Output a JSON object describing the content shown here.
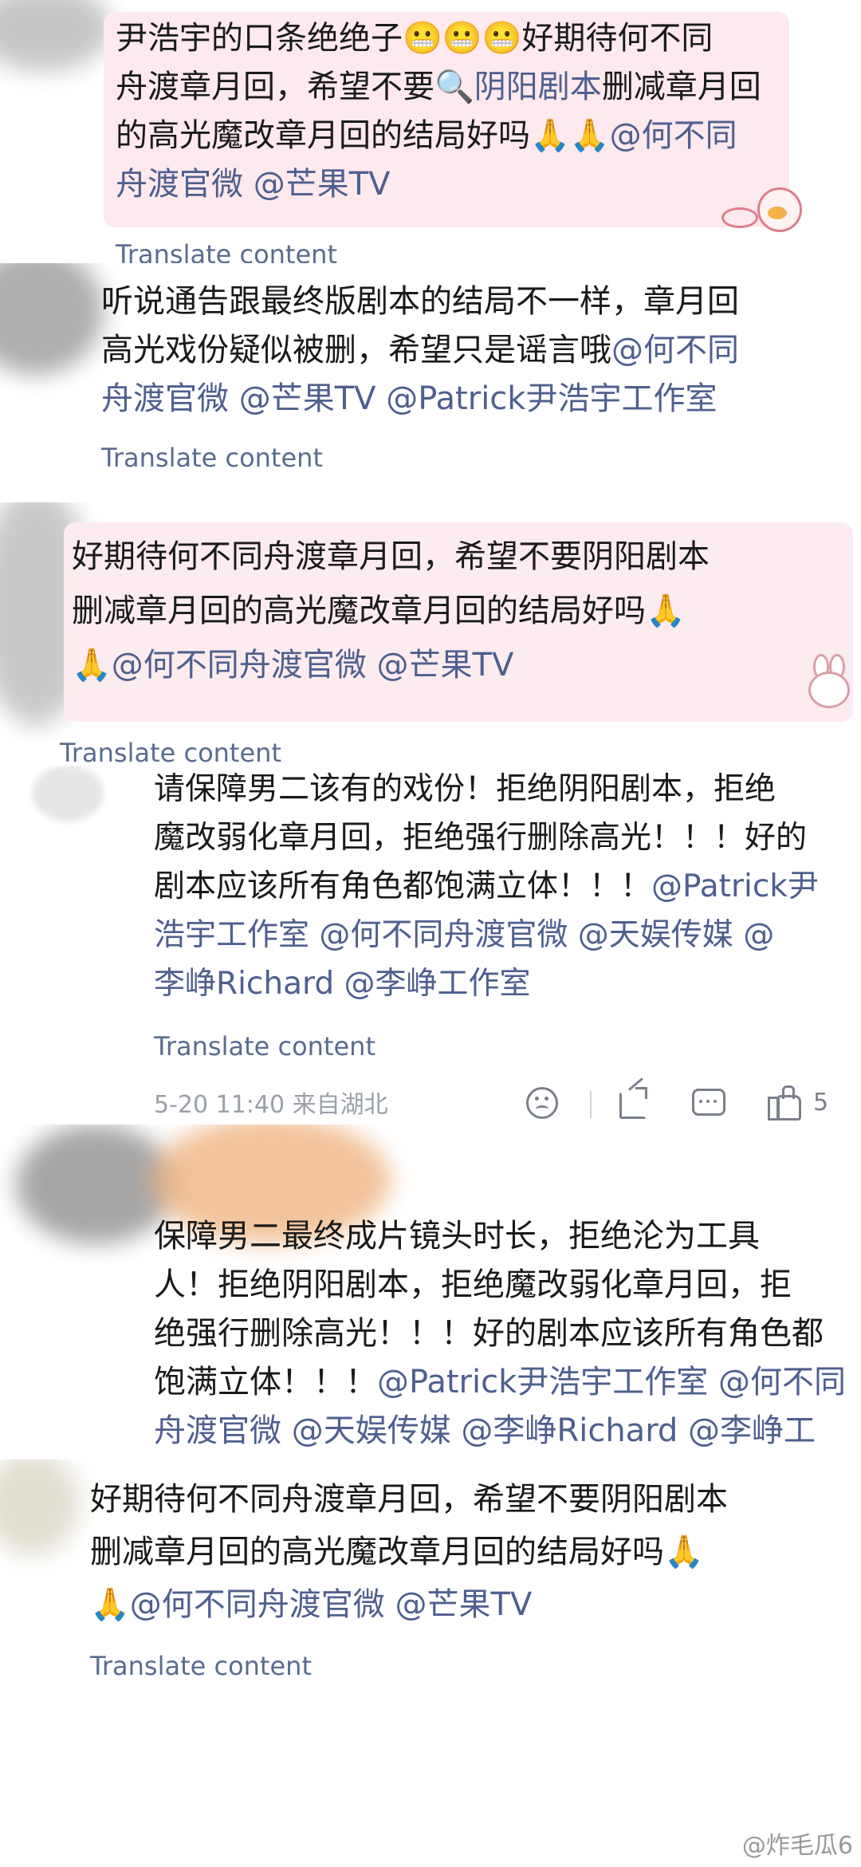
{
  "comment1": {
    "line1": "尹浩宇的口条绝绝子😬😬😬好期待何不同",
    "line2a": "舟渡章月回，希望不要",
    "link": "🔍阴阳剧本",
    "line2b": "删减章月回",
    "line3": "的高光魔改章月回的结局好吗🙏🙏",
    "mention1": "@何不同",
    "line4_mention": "舟渡官微",
    "mention2": "@芒果TV",
    "translate": "Translate content"
  },
  "comment2": {
    "line1": "听说通告跟最终版剧本的结局不一样，章月回",
    "line2": "高光戏份疑似被删，希望只是谣言哦",
    "mention1": "@何不同",
    "line3": "舟渡官微 @芒果TV @Patrick尹浩宇工作室",
    "translate": "Translate content"
  },
  "comment3": {
    "line1": "好期待何不同舟渡章月回，希望不要阴阳剧本",
    "line2": "删减章月回的高光魔改章月回的结局好吗🙏",
    "line3": "🙏@何不同舟渡官微 @芒果TV",
    "translate": "Translate content"
  },
  "comment4": {
    "line1": "请保障男二该有的戏份！拒绝阴阳剧本，拒绝",
    "line2": "魔改弱化章月回，拒绝强行删除高光！！！好的",
    "line3": "剧本应该所有角色都饱满立体！！！",
    "line3_mention": "@Patrick尹",
    "line4": "浩宇工作室 @何不同舟渡官微 @天娱传媒 @",
    "line5": "李峥Richard @李峥工作室",
    "translate": "Translate content",
    "timestamp": "5-20 11:40 来自湖北",
    "like_count": "5"
  },
  "comment5": {
    "line1": "保障男二最终成片镜头时长，拒绝沦为工具",
    "line2": "人！拒绝阴阳剧本，拒绝魔改弱化章月回，拒",
    "line3": "绝强行删除高光！！！好的剧本应该所有角色都",
    "line4a": "饱满立体！！！",
    "line4b": "@Patrick尹浩宇工作室 @何不同",
    "line5": "舟渡官微 @天娱传媒 @李峥Richard @李峥工"
  },
  "comment6": {
    "line1": "好期待何不同舟渡章月回，希望不要阴阳剧本",
    "line2": "删减章月回的高光魔改章月回的结局好吗🙏",
    "line3": "🙏@何不同舟渡官微 @芒果TV",
    "translate": "Translate content"
  },
  "watermark": "@炸毛瓜6"
}
